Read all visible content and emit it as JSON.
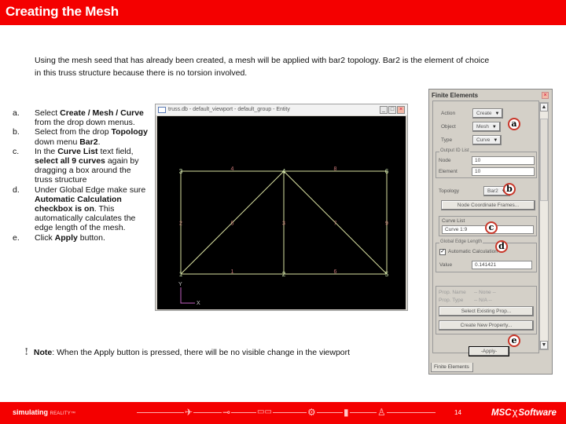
{
  "header": {
    "title": "Creating the Mesh"
  },
  "intro": "Using the mesh seed that has already been created, a mesh will be applied with bar2 topology. Bar2 is the element of choice in this truss structure because there is no torsion involved.",
  "steps": [
    {
      "label": "a.",
      "parts": [
        [
          "Select ",
          false
        ],
        [
          "Create / Mesh / Curve",
          true
        ],
        [
          " from the drop down menus.",
          false
        ]
      ]
    },
    {
      "label": "b.",
      "parts": [
        [
          "Select from the drop ",
          false
        ],
        [
          "Topology",
          true
        ],
        [
          " down menu ",
          false
        ],
        [
          "Bar2",
          true
        ],
        [
          ".",
          false
        ]
      ]
    },
    {
      "label": "c.",
      "parts": [
        [
          "In the ",
          false
        ],
        [
          "Curve List",
          true
        ],
        [
          " text field, ",
          false
        ],
        [
          "select all 9 curves",
          true
        ],
        [
          " again by dragging a box around the truss structure",
          false
        ]
      ]
    },
    {
      "label": "d.",
      "parts": [
        [
          "Under Global Edge make sure ",
          false
        ],
        [
          "Automatic Calculation checkbox is on",
          true
        ],
        [
          ". This automatically calculates the edge length of the mesh.",
          false
        ]
      ]
    },
    {
      "label": "e.",
      "parts": [
        [
          "Click ",
          false
        ],
        [
          "Apply",
          true
        ],
        [
          " button.",
          false
        ]
      ]
    }
  ],
  "viewport": {
    "title": "truss.db - default_viewport - default_group - Entity",
    "buttons": {
      "minimize": "_",
      "maximize": "□",
      "close": "×"
    },
    "points": [
      {
        "id": "1",
        "x": 0,
        "y": 0
      },
      {
        "id": "2",
        "x": 1,
        "y": 0
      },
      {
        "id": "3",
        "x": 0,
        "y": 1
      },
      {
        "id": "4",
        "x": 1,
        "y": 1
      },
      {
        "id": "5",
        "x": 2,
        "y": 0
      },
      {
        "id": "6",
        "x": 2,
        "y": 1
      }
    ],
    "curves": [
      {
        "id": "1",
        "from": "1",
        "to": "2"
      },
      {
        "id": "2",
        "from": "1",
        "to": "3"
      },
      {
        "id": "4",
        "from": "3",
        "to": "4"
      },
      {
        "id": "5",
        "from": "1",
        "to": "4"
      },
      {
        "id": "3",
        "from": "2",
        "to": "4"
      },
      {
        "id": "6",
        "from": "2",
        "to": "5"
      },
      {
        "id": "7",
        "from": "4",
        "to": "5"
      },
      {
        "id": "8",
        "from": "4",
        "to": "6"
      },
      {
        "id": "9",
        "from": "5",
        "to": "6"
      }
    ],
    "axis": {
      "x": "X",
      "y": "Y"
    },
    "colors": {
      "background": "#000000",
      "curve": "#d8e0a0",
      "curve_label": "#c87878",
      "point": "#d0e8b0",
      "axis": "#c060c0"
    }
  },
  "panel": {
    "title": "Finite Elements",
    "action": {
      "label": "Action",
      "value": "Create"
    },
    "object": {
      "label": "Object",
      "value": "Mesh"
    },
    "type": {
      "label": "Type",
      "value": "Curve"
    },
    "output_ids": {
      "title": "Output ID List",
      "node_label": "Node",
      "node_value": "10",
      "element_label": "Element",
      "element_value": "10"
    },
    "topology": {
      "label": "Topology",
      "value": "Bar2"
    },
    "node_coordinate_frames": "Node Coordinate Frames...",
    "curve_list": {
      "title": "Curve List",
      "value": "Curve 1:9"
    },
    "global_edge": {
      "title": "Global Edge Length",
      "auto_calc_label": "Automatic Calculation",
      "auto_calc_checked": true,
      "value_label": "Value",
      "value": "0.141421"
    },
    "prop_name": {
      "label": "Prop. Name",
      "value": "-- None --"
    },
    "prop_type": {
      "label": "Prop. Type",
      "value": "-- N/A --"
    },
    "select_existing_prop": "Select Existing Prop...",
    "create_new_property": "Create New Property...",
    "apply": "-Apply-",
    "tab": "Finite Elements"
  },
  "callouts": [
    "a",
    "b",
    "c",
    "d",
    "e"
  ],
  "note": {
    "icon": "!",
    "bold": "Note",
    "text": ": When the Apply button is pressed, there will be no visible change in the viewport"
  },
  "footer": {
    "brand_bold": "simulating",
    "brand_rest": "REALITY™",
    "page_number": "14",
    "logo_left": "MSC",
    "logo_right": "Software",
    "icons": [
      "airplane-icon",
      "car-icon",
      "bus-icon",
      "gear-icon",
      "phone-icon",
      "person-icon"
    ]
  },
  "colors": {
    "brand_red": "#f40000",
    "callout_ring": "#c8372a"
  }
}
